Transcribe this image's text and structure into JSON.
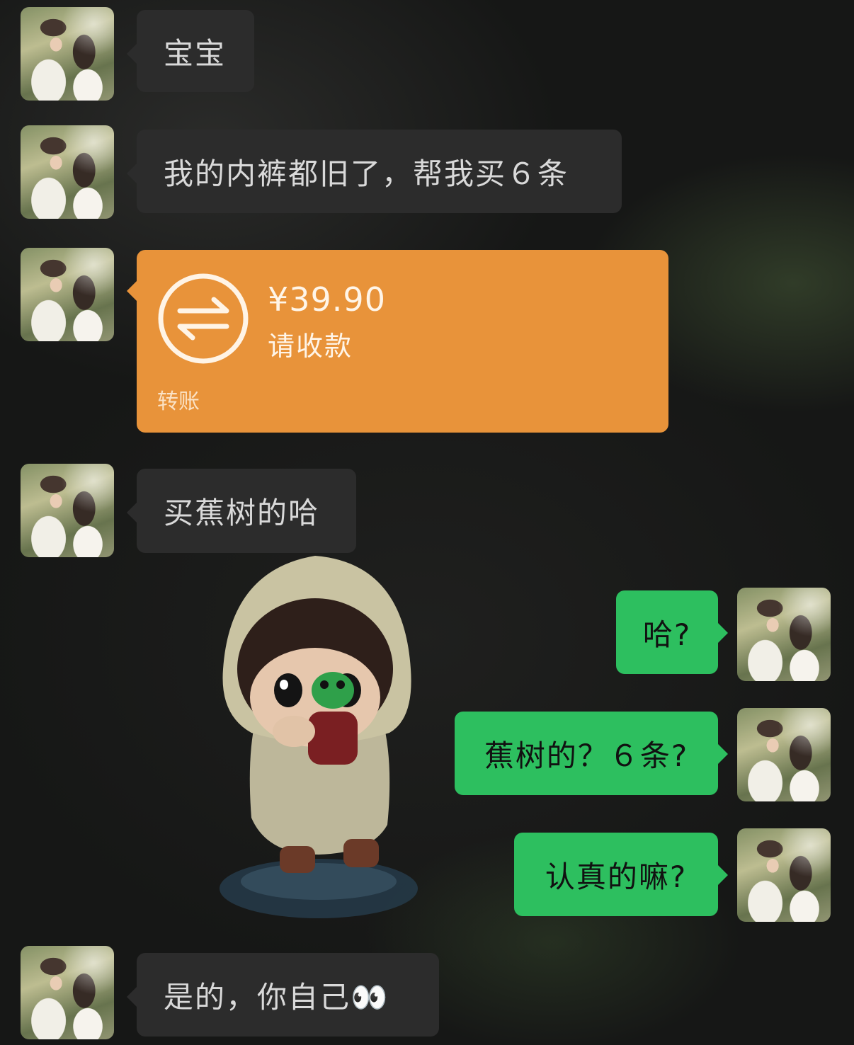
{
  "messages": [
    {
      "sender": "other",
      "text": "宝宝"
    },
    {
      "sender": "other",
      "text": "我的内裤都旧了，帮我买６条"
    },
    {
      "sender": "other",
      "type": "transfer",
      "amount": "¥39.90",
      "status": "请收款",
      "label": "转账"
    },
    {
      "sender": "other",
      "text": "买蕉树的哈"
    },
    {
      "sender": "me",
      "text": "哈?"
    },
    {
      "sender": "me",
      "text": "蕉树的？６条?"
    },
    {
      "sender": "me",
      "text": "认真的嘛?"
    },
    {
      "sender": "other",
      "text": "是的，你自己👀"
    }
  ],
  "colors": {
    "incoming_bubble": "#2c2c2c",
    "outgoing_bubble": "#2dbf5f",
    "transfer_card": "#e8933a"
  },
  "icons": {
    "transfer": "transfer-arrows-icon",
    "avatar": "couple-photo-avatar"
  }
}
